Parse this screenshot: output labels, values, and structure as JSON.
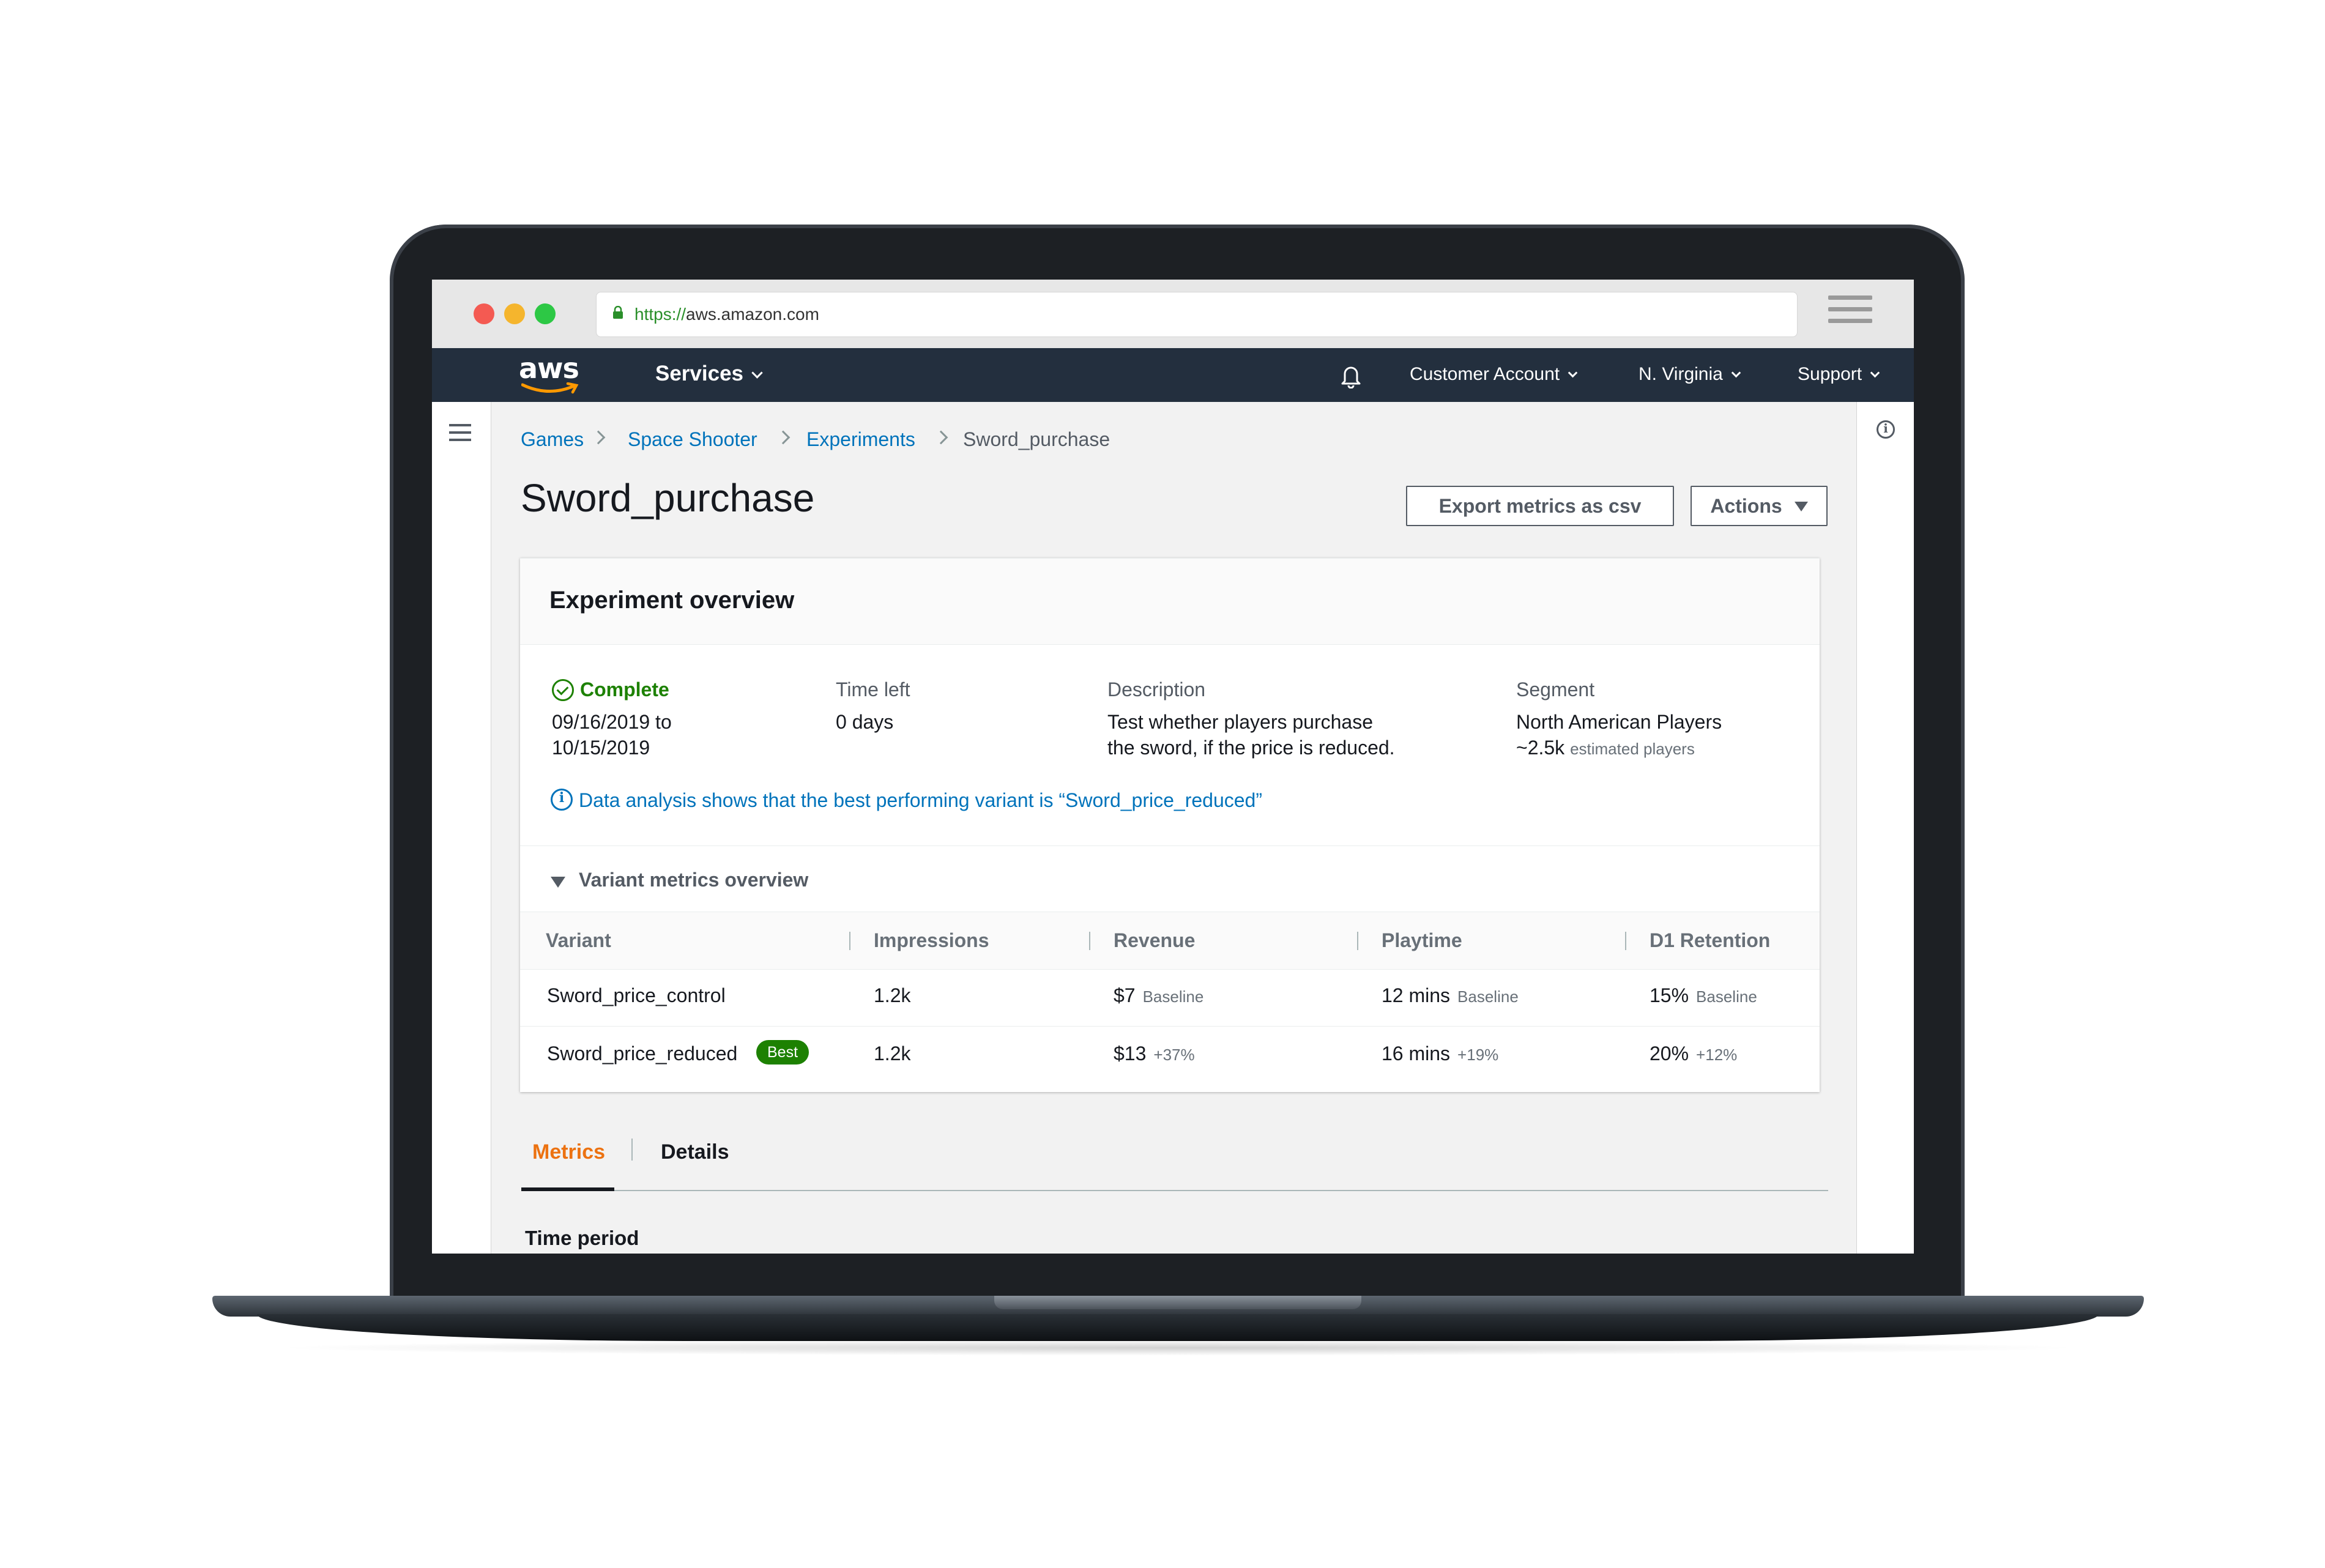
{
  "browser": {
    "url_protocol": "https://",
    "url_host": "aws.amazon.com",
    "window_controls": [
      "#f45a52",
      "#f5b52d",
      "#2dc845"
    ]
  },
  "nav": {
    "logo": "aws",
    "services": "Services",
    "notifications_icon": "bell-icon",
    "account": "Customer Account",
    "region": "N. Virginia",
    "support": "Support"
  },
  "breadcrumb": [
    "Games",
    "Space Shooter",
    "Experiments",
    "Sword_purchase"
  ],
  "page": {
    "title": "Sword_purchase",
    "export_label": "Export metrics as csv",
    "actions_label": "Actions"
  },
  "overview": {
    "title": "Experiment overview",
    "status": "Complete",
    "date_line1": "09/16/2019 to",
    "date_line2": "10/15/2019",
    "time_left_label": "Time left",
    "time_left_value": "0 days",
    "description_label": "Description",
    "description_line1": "Test whether players purchase",
    "description_line2": "the sword, if the price is reduced.",
    "segment_label": "Segment",
    "segment_value": "North American Players",
    "segment_count": "~2.5k",
    "segment_count_note": "estimated players",
    "info_message": "Data analysis shows that the best performing variant is “Sword_price_reduced”"
  },
  "variant_metrics": {
    "title": "Variant metrics overview",
    "columns": [
      "Variant",
      "Impressions",
      "Revenue",
      "Playtime",
      "D1 Retention"
    ],
    "rows": [
      {
        "variant": "Sword_price_control",
        "badge": "",
        "impressions": "1.2k",
        "revenue": "$7",
        "revenue_note": "Baseline",
        "playtime": "12 mins",
        "playtime_note": "Baseline",
        "retention": "15%",
        "retention_note": "Baseline"
      },
      {
        "variant": "Sword_price_reduced",
        "badge": "Best",
        "impressions": "1.2k",
        "revenue": "$13",
        "revenue_note": "+37%",
        "playtime": "16 mins",
        "playtime_note": "+19%",
        "retention": "20%",
        "retention_note": "+12%"
      }
    ]
  },
  "tabs": [
    "Metrics",
    "Details"
  ],
  "time_period_label": "Time period",
  "colors": {
    "nav_bg": "#232f3e",
    "link": "#0073bb",
    "success": "#1d8102",
    "active_tab": "#ec7211"
  }
}
